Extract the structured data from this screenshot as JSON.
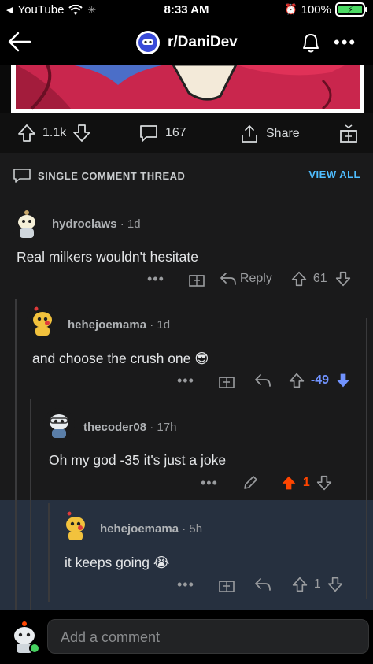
{
  "status_bar": {
    "back_app": "YouTube",
    "time": "8:33 AM",
    "battery": "100%"
  },
  "header": {
    "subreddit": "r/DaniDev"
  },
  "post_actions": {
    "upvotes": "1.1k",
    "comments": "167",
    "share_label": "Share"
  },
  "thread": {
    "label": "SINGLE COMMENT THREAD",
    "view_all": "VIEW ALL"
  },
  "comments": [
    {
      "user": "hydroclaws",
      "age": "1d",
      "text": "Real milkers wouldn't hesitate",
      "reply_label": "Reply",
      "score": "61"
    },
    {
      "user": "hehejoemama",
      "age": "1d",
      "text": "and choose the crush one",
      "emoji": "😎",
      "score": "-49"
    },
    {
      "user": "thecoder08",
      "age": "17h",
      "text": "Oh my god -35 it's just a joke",
      "score": "1"
    },
    {
      "user": "hehejoemama",
      "age": "5h",
      "text": "it keeps going",
      "emoji": "😭",
      "score": "1"
    }
  ],
  "composer": {
    "placeholder": "Add a comment"
  },
  "colors": {
    "upvote_active": "#ff4500",
    "downvote_active": "#7193ff",
    "link_blue": "#4fbdff",
    "highlight_bg": "#26303f"
  }
}
